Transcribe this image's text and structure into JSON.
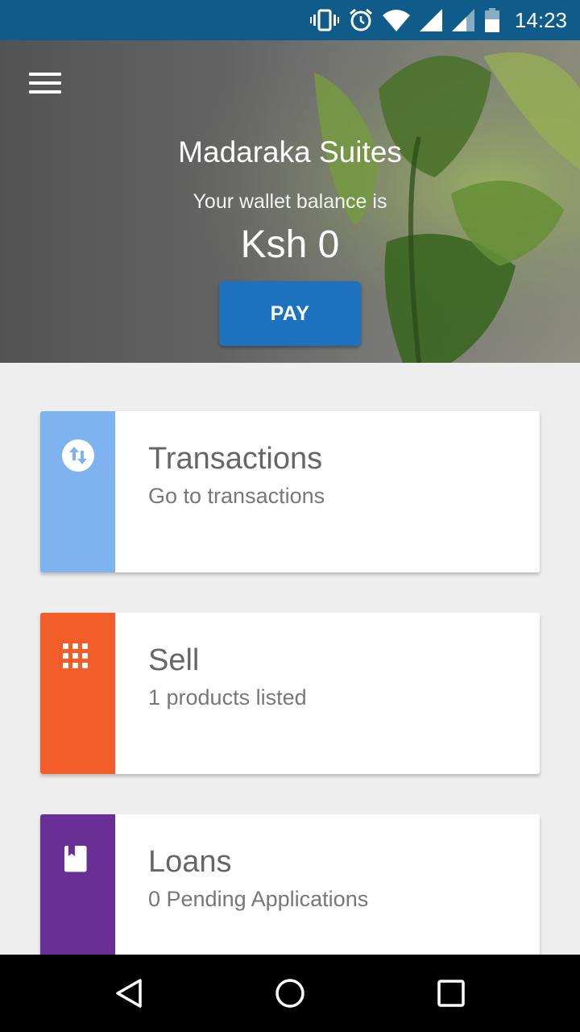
{
  "status_bar": {
    "time": "14:23",
    "icons": [
      "vibrate-icon",
      "alarm-icon",
      "wifi-icon",
      "signal-icon",
      "signal-icon",
      "battery-icon"
    ]
  },
  "header": {
    "menu_icon": "hamburger-menu-icon",
    "title": "Madaraka Suites",
    "wallet_label": "Your wallet balance is",
    "balance": "Ksh 0",
    "pay_label": "PAY",
    "pay_color": "#1c72bf"
  },
  "cards": [
    {
      "title": "Transactions",
      "subtitle": "Go to transactions",
      "color": "#7eb3f0",
      "icon": "swap-arrows-icon"
    },
    {
      "title": "Sell",
      "subtitle": "1 products listed",
      "color": "#f25d2a",
      "icon": "apps-grid-icon"
    },
    {
      "title": "Loans",
      "subtitle": "0 Pending Applications",
      "color": "#6a2f96",
      "icon": "book-icon"
    }
  ],
  "nav_bar": {
    "buttons": [
      "back-icon",
      "home-icon",
      "recents-icon"
    ]
  }
}
